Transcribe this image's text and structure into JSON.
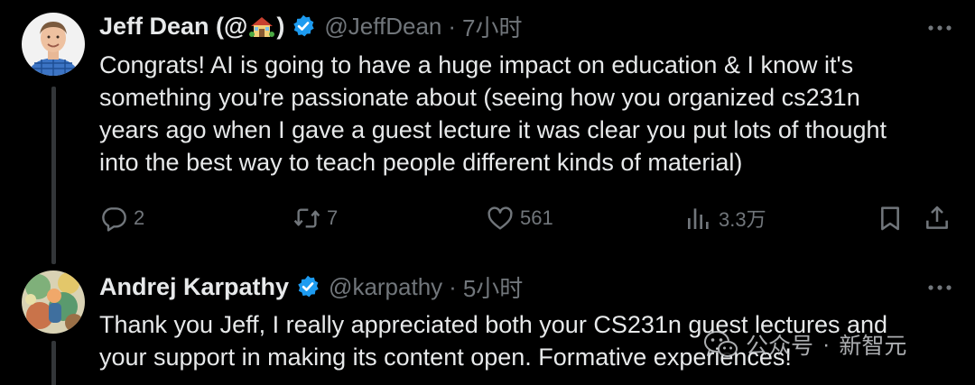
{
  "tweets": [
    {
      "author_name": "Jeff Dean (@",
      "author_name_end": ")",
      "handle": "@JeffDean",
      "separator": "·",
      "time": "7小时",
      "text_lines": [
        "Congrats! AI is going to have a huge impact on education & I know it's",
        "something you're passionate about (seeing how you organized cs231n",
        "years ago when I gave a guest lecture it was clear you put lots of thought",
        "into the best way to teach people different kinds of material)"
      ],
      "actions": {
        "replies": "2",
        "reposts": "7",
        "likes": "561",
        "views": "3.3万"
      }
    },
    {
      "author_name": "Andrej Karpathy",
      "handle": "@karpathy",
      "separator": "·",
      "time": "5小时",
      "text_lines": [
        "Thank you Jeff, I really appreciated both your CS231n guest lectures and",
        "your support in making its content open. Formative experiences!"
      ]
    }
  ],
  "watermark": {
    "source": "公众号",
    "dot": "·",
    "brand": "新智元"
  },
  "colors": {
    "background": "#000000",
    "text_primary": "#e7e9ea",
    "text_secondary": "#71767b",
    "verified_blue": "#1d9bf0",
    "thread_line": "#333639"
  },
  "icons": [
    "more-icon",
    "verified-badge-icon",
    "house-emoji-icon",
    "reply-icon",
    "repost-icon",
    "like-icon",
    "views-icon",
    "bookmark-icon",
    "share-icon",
    "wechat-icon"
  ]
}
